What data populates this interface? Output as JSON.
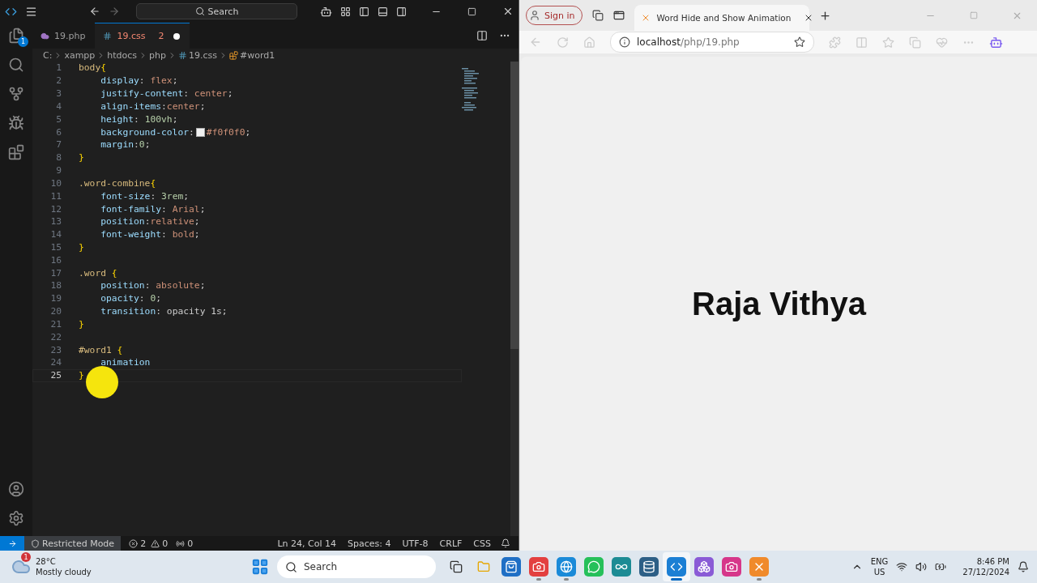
{
  "vscode": {
    "title_bar": {
      "search": "Search"
    },
    "activity_bar": [
      {
        "kind": "explorer",
        "badge": "1"
      },
      {
        "kind": "search"
      },
      {
        "kind": "source-control"
      },
      {
        "kind": "run"
      },
      {
        "kind": "extensions"
      }
    ],
    "activity_bar_bottom": [
      {
        "kind": "account"
      },
      {
        "kind": "settings"
      }
    ],
    "tabs": [
      {
        "label": "19.php",
        "kind": "php",
        "selected": false,
        "modified": false
      },
      {
        "label": "19.css",
        "kind": "css",
        "selected": true,
        "modified": true,
        "problems": "2"
      }
    ],
    "breadcrumbs": [
      {
        "label": "C:",
        "kind": "folder"
      },
      {
        "label": "xampp",
        "kind": "folder"
      },
      {
        "label": "htdocs",
        "kind": "folder"
      },
      {
        "label": "php",
        "kind": "folder"
      },
      {
        "label": "19.css",
        "kind": "css"
      },
      {
        "label": "#word1",
        "kind": "symbol"
      }
    ],
    "lines": [
      {
        "number": "1",
        "current": false,
        "tokens": [
          {
            "text": "body",
            "kind": "selector"
          },
          {
            "text": "{",
            "kind": "brace"
          }
        ]
      },
      {
        "number": "2",
        "current": false,
        "tokens": [
          {
            "text": "    display",
            "kind": "property"
          },
          {
            "text": ": ",
            "kind": "punct"
          },
          {
            "text": "flex",
            "kind": "value"
          },
          {
            "text": ";",
            "kind": "punct"
          }
        ]
      },
      {
        "number": "3",
        "current": false,
        "tokens": [
          {
            "text": "    justify-content",
            "kind": "property"
          },
          {
            "text": ": ",
            "kind": "punct"
          },
          {
            "text": "center",
            "kind": "value"
          },
          {
            "text": ";",
            "kind": "punct"
          }
        ]
      },
      {
        "number": "4",
        "current": false,
        "tokens": [
          {
            "text": "    align-items",
            "kind": "property"
          },
          {
            "text": ":",
            "kind": "punct"
          },
          {
            "text": "center",
            "kind": "value"
          },
          {
            "text": ";",
            "kind": "punct"
          }
        ]
      },
      {
        "number": "5",
        "current": false,
        "tokens": [
          {
            "text": "    height",
            "kind": "property"
          },
          {
            "text": ": ",
            "kind": "punct"
          },
          {
            "text": "100vh",
            "kind": "number"
          },
          {
            "text": ";",
            "kind": "punct"
          }
        ]
      },
      {
        "number": "6",
        "current": false,
        "tokens": [
          {
            "text": "    background-color",
            "kind": "property"
          },
          {
            "text": ":",
            "kind": "punct"
          },
          {
            "kind": "swatch",
            "color": "#f0f0f0"
          },
          {
            "text": "#f0f0f0",
            "kind": "value"
          },
          {
            "text": ";",
            "kind": "punct"
          }
        ]
      },
      {
        "number": "7",
        "current": false,
        "tokens": [
          {
            "text": "    margin",
            "kind": "property"
          },
          {
            "text": ":",
            "kind": "punct"
          },
          {
            "text": "0",
            "kind": "number"
          },
          {
            "text": ";",
            "kind": "punct"
          }
        ]
      },
      {
        "number": "8",
        "current": false,
        "tokens": [
          {
            "text": "}",
            "kind": "brace"
          }
        ]
      },
      {
        "number": "9",
        "current": false
      },
      {
        "number": "10",
        "current": false,
        "tokens": [
          {
            "text": ".word-combine",
            "kind": "selector"
          },
          {
            "text": "{",
            "kind": "brace"
          }
        ]
      },
      {
        "number": "11",
        "current": false,
        "tokens": [
          {
            "text": "    font-size",
            "kind": "property"
          },
          {
            "text": ": ",
            "kind": "punct"
          },
          {
            "text": "3rem",
            "kind": "number"
          },
          {
            "text": ";",
            "kind": "punct"
          }
        ]
      },
      {
        "number": "12",
        "current": false,
        "tokens": [
          {
            "text": "    font-family",
            "kind": "property"
          },
          {
            "text": ": ",
            "kind": "punct"
          },
          {
            "text": "Arial",
            "kind": "value"
          },
          {
            "text": ";",
            "kind": "punct"
          }
        ]
      },
      {
        "number": "13",
        "current": false,
        "tokens": [
          {
            "text": "    position",
            "kind": "property"
          },
          {
            "text": ":",
            "kind": "punct"
          },
          {
            "text": "relative",
            "kind": "value"
          },
          {
            "text": ";",
            "kind": "punct"
          }
        ]
      },
      {
        "number": "14",
        "current": false,
        "tokens": [
          {
            "text": "    font-weight",
            "kind": "property"
          },
          {
            "text": ": ",
            "kind": "punct"
          },
          {
            "text": "bold",
            "kind": "value"
          },
          {
            "text": ";",
            "kind": "punct"
          }
        ]
      },
      {
        "number": "15",
        "current": false,
        "tokens": [
          {
            "text": "}",
            "kind": "brace"
          }
        ]
      },
      {
        "number": "16",
        "current": false
      },
      {
        "number": "17",
        "current": false,
        "tokens": [
          {
            "text": ".word ",
            "kind": "selector"
          },
          {
            "text": "{",
            "kind": "brace"
          }
        ]
      },
      {
        "number": "18",
        "current": false,
        "tokens": [
          {
            "text": "    position",
            "kind": "property"
          },
          {
            "text": ": ",
            "kind": "punct"
          },
          {
            "text": "absolute",
            "kind": "value"
          },
          {
            "text": ";",
            "kind": "punct"
          }
        ]
      },
      {
        "number": "19",
        "current": false,
        "tokens": [
          {
            "text": "    opacity",
            "kind": "property"
          },
          {
            "text": ": ",
            "kind": "punct"
          },
          {
            "text": "0",
            "kind": "number"
          },
          {
            "text": ";",
            "kind": "punct"
          }
        ]
      },
      {
        "number": "20",
        "current": false,
        "tokens": [
          {
            "text": "    transition",
            "kind": "property"
          },
          {
            "text": ": ",
            "kind": "punct"
          },
          {
            "text": "opacity 1s",
            "kind": "punct"
          },
          {
            "text": ";",
            "kind": "punct"
          }
        ]
      },
      {
        "number": "21",
        "current": false,
        "tokens": [
          {
            "text": "}",
            "kind": "brace"
          }
        ]
      },
      {
        "number": "22",
        "current": false
      },
      {
        "number": "23",
        "current": false,
        "tokens": [
          {
            "text": "#word1 ",
            "kind": "selector"
          },
          {
            "text": "{",
            "kind": "brace"
          }
        ]
      },
      {
        "number": "24",
        "current": false,
        "tokens": [
          {
            "text": "    animation",
            "kind": "property"
          }
        ]
      },
      {
        "number": "25",
        "current": true,
        "tokens": [
          {
            "text": "}",
            "kind": "brace"
          }
        ]
      }
    ],
    "status_bar": {
      "mode": "Restricted Mode",
      "errors": "2",
      "warnings": "0",
      "ports": "0",
      "items": [
        "Ln 24, Col 14",
        "Spaces: 4",
        "UTF-8",
        "CRLF",
        "CSS"
      ]
    }
  },
  "browser": {
    "sign_in": "Sign in",
    "tab_title": "Word Hide and Show Animation",
    "url": {
      "host": "localhost",
      "path": "/php/19.php"
    },
    "page_heading": "Raja Vithya"
  },
  "taskbar": {
    "weather": {
      "badge": "1",
      "temperature": "28°C",
      "condition": "Mostly cloudy"
    },
    "search": "Search",
    "apps": [
      {
        "kind": "task-view",
        "running": false,
        "active": false
      },
      {
        "kind": "explorer",
        "running": false,
        "active": false
      },
      {
        "kind": "store",
        "running": false,
        "active": false
      },
      {
        "kind": "recorder",
        "running": true,
        "active": false
      },
      {
        "kind": "edge",
        "running": true,
        "active": false
      },
      {
        "kind": "whatsapp",
        "running": false,
        "active": false
      },
      {
        "kind": "arduino",
        "running": false,
        "active": false
      },
      {
        "kind": "mysql",
        "running": false,
        "active": false
      },
      {
        "kind": "vscode",
        "running": true,
        "active": true
      },
      {
        "kind": "vstudio",
        "running": false,
        "active": false
      },
      {
        "kind": "instagram",
        "running": false,
        "active": false
      },
      {
        "kind": "xampp",
        "running": true,
        "active": false
      }
    ],
    "language": "ENG",
    "region": "US",
    "time": "8:46 PM",
    "date": "27/12/2024"
  }
}
